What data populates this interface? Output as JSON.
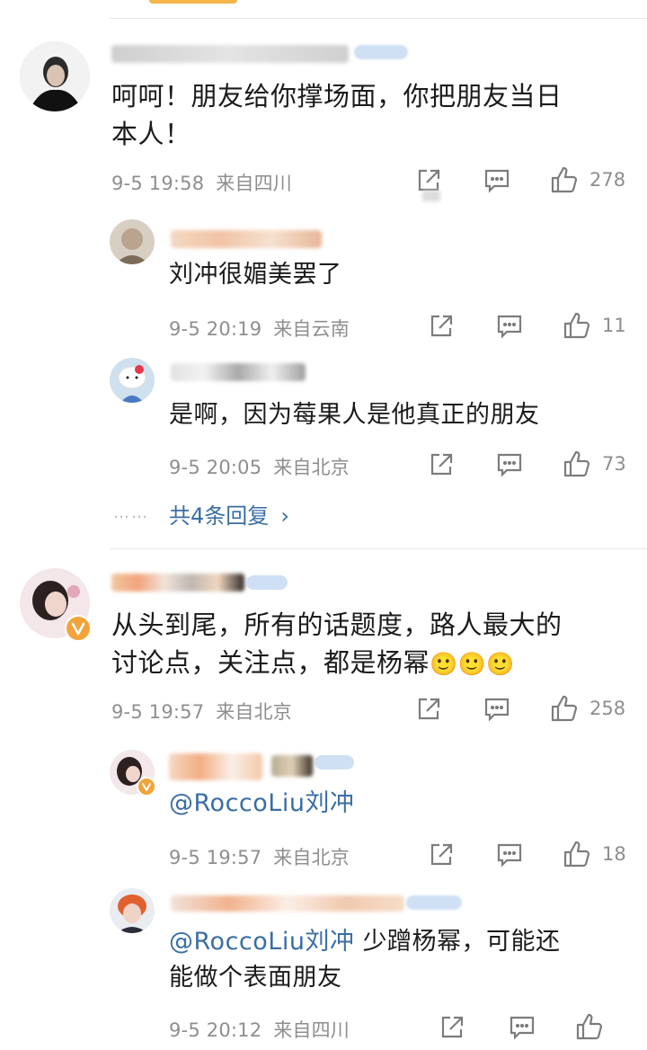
{
  "comments": [
    {
      "text": "呵呵！朋友给你撑场面，你把朋友当日本人！",
      "text_line1": "呵呵！朋友给你撑场面，你把朋友当日",
      "text_line2": "本人！",
      "time": "9-5 19:58",
      "location": "来自四川",
      "likes": "278",
      "replies": [
        {
          "text": "刘冲很媚美罢了",
          "time": "9-5 20:19",
          "location": "来自云南",
          "likes": "11"
        },
        {
          "text": "是啊，因为莓果人是他真正的朋友",
          "time": "9-5 20:05",
          "location": "来自北京",
          "likes": "73"
        }
      ],
      "more_replies_dots": "……",
      "more_replies_label": "共4条回复",
      "more_replies_chevron": "›"
    },
    {
      "text_line1": "从头到尾，所有的话题度，路人最大的",
      "text_line2": "讨论点，关注点，都是杨幂",
      "emoji": "🙂🙂🙂",
      "time": "9-5 19:57",
      "location": "来自北京",
      "likes": "258",
      "replies": [
        {
          "mention": "@RoccoLiu刘冲",
          "text": "",
          "time": "9-5 19:57",
          "location": "来自北京",
          "likes": "18"
        },
        {
          "mention": "@RoccoLiu刘冲",
          "text_line1": " 少蹭杨幂，可能还",
          "text_line2": "能做个表面朋友",
          "time": "9-5 20:12",
          "location": "来自四川",
          "likes": ""
        }
      ]
    }
  ],
  "icons": {
    "share": "share-icon",
    "comment": "comment-icon",
    "like": "thumbs-up-icon",
    "verified": "verified-badge-icon"
  },
  "colors": {
    "mention": "#3a6ea5",
    "meta": "#8e8e8e",
    "verified": "#f2a33a"
  }
}
